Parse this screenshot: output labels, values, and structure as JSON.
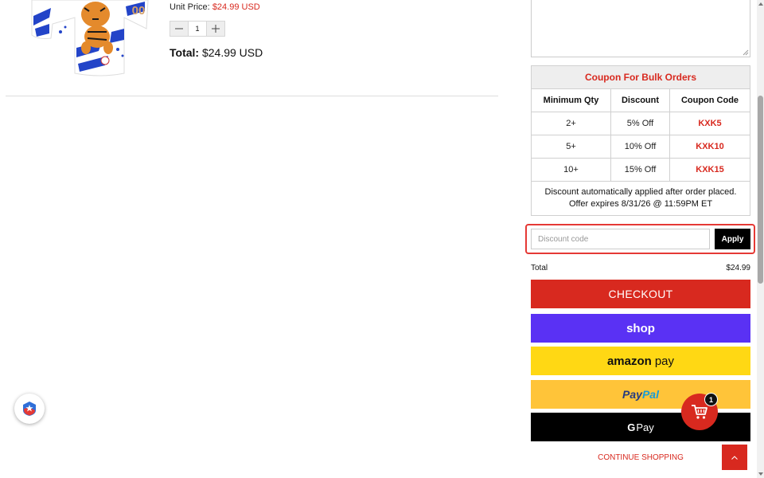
{
  "product": {
    "image_alt": "tiger mascot jersey",
    "jersey_number": "00",
    "unit_price_label": "Unit Price:",
    "unit_price_value": "$24.99 USD",
    "quantity": "1",
    "total_label": "Total:",
    "total_value": "$24.99 USD"
  },
  "coupon": {
    "title": "Coupon For Bulk Orders",
    "headers": [
      "Minimum Qty",
      "Discount",
      "Coupon Code"
    ],
    "rows": [
      {
        "qty": "2+",
        "discount": "5% Off",
        "code": "KXK5"
      },
      {
        "qty": "5+",
        "discount": "10% Off",
        "code": "KXK10"
      },
      {
        "qty": "10+",
        "discount": "15% Off",
        "code": "KXK15"
      }
    ],
    "note_line1": "Discount automatically applied after order placed.",
    "note_line2": "Offer expires 8/31/26 @ 11:59PM ET"
  },
  "discount": {
    "placeholder": "Discount code",
    "apply_label": "Apply"
  },
  "summary": {
    "total_label": "Total",
    "total_value": "$24.99"
  },
  "buttons": {
    "checkout": "CHECKOUT",
    "shop_pay": "shop",
    "amazon_pay_brand": "amazon",
    "amazon_pay_suffix": "pay",
    "paypal_part1": "Pay",
    "paypal_part2": "Pal",
    "gpay_g": "G",
    "gpay_text": "Pay",
    "continue": "CONTINUE SHOPPING"
  },
  "cart": {
    "count": "1"
  },
  "colors": {
    "accent_red": "#d8291f",
    "shop_purple": "#5a31f4",
    "amazon_yellow": "#ffd814",
    "paypal_gold": "#ffc439",
    "highlight_border": "#e53935"
  },
  "icons": {
    "minus": "minus-icon",
    "plus": "plus-icon",
    "cart": "cart-icon",
    "chevron_up": "chevron-up-icon",
    "verified_badge": "shield-star-icon"
  }
}
